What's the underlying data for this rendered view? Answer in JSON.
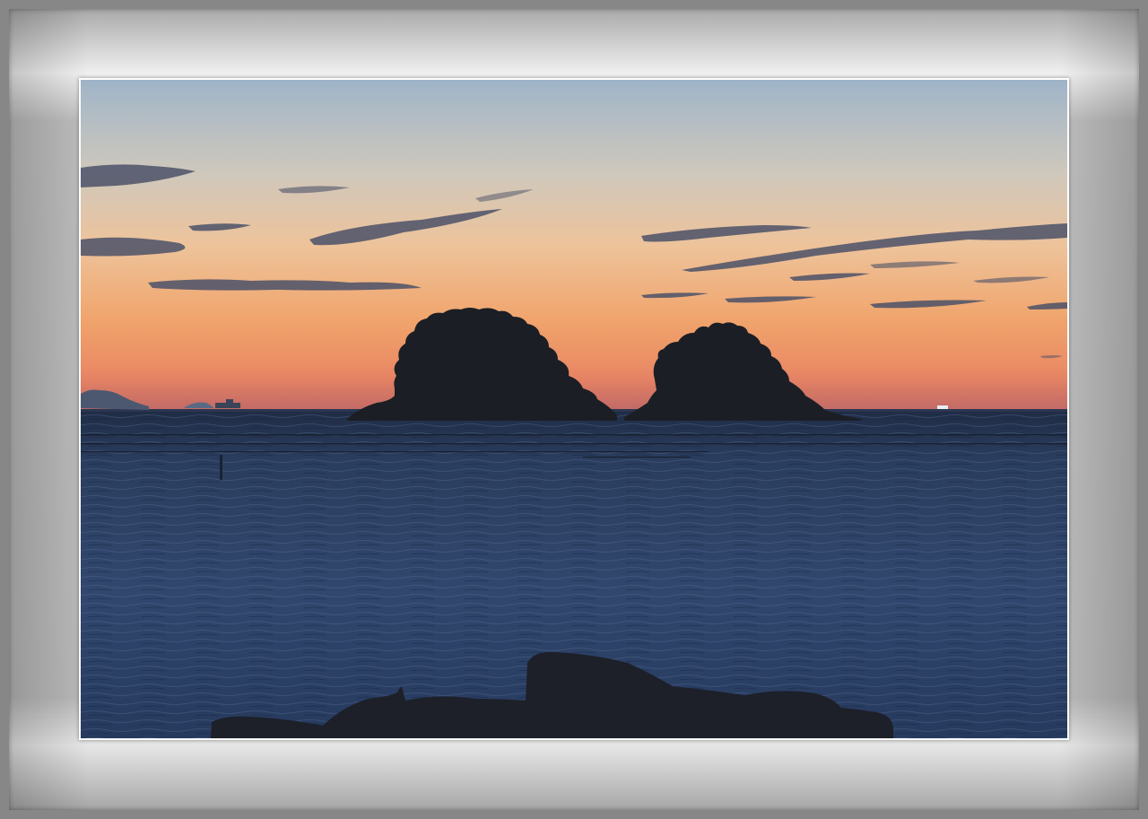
{
  "scene": {
    "subject": "sunset-seascape",
    "elements": [
      "twin-islands",
      "foreground-rocks",
      "distant-ships",
      "distant-headland",
      "streaky-clouds",
      "calm-sea"
    ]
  },
  "colors": {
    "frame": "#878787",
    "mat_light": "#f0f0f0",
    "mat_mid": "#bdbdbd",
    "sky_top": "#9db3c6",
    "sky_mid": "#e6c7a4",
    "sky_glow": "#f0a06a",
    "sky_horizon": "#e07a5a",
    "sea_top": "#2c3f5e",
    "sea_bottom": "#24385c",
    "silhouette": "#1a1d24",
    "cloud": "#4a5068"
  }
}
